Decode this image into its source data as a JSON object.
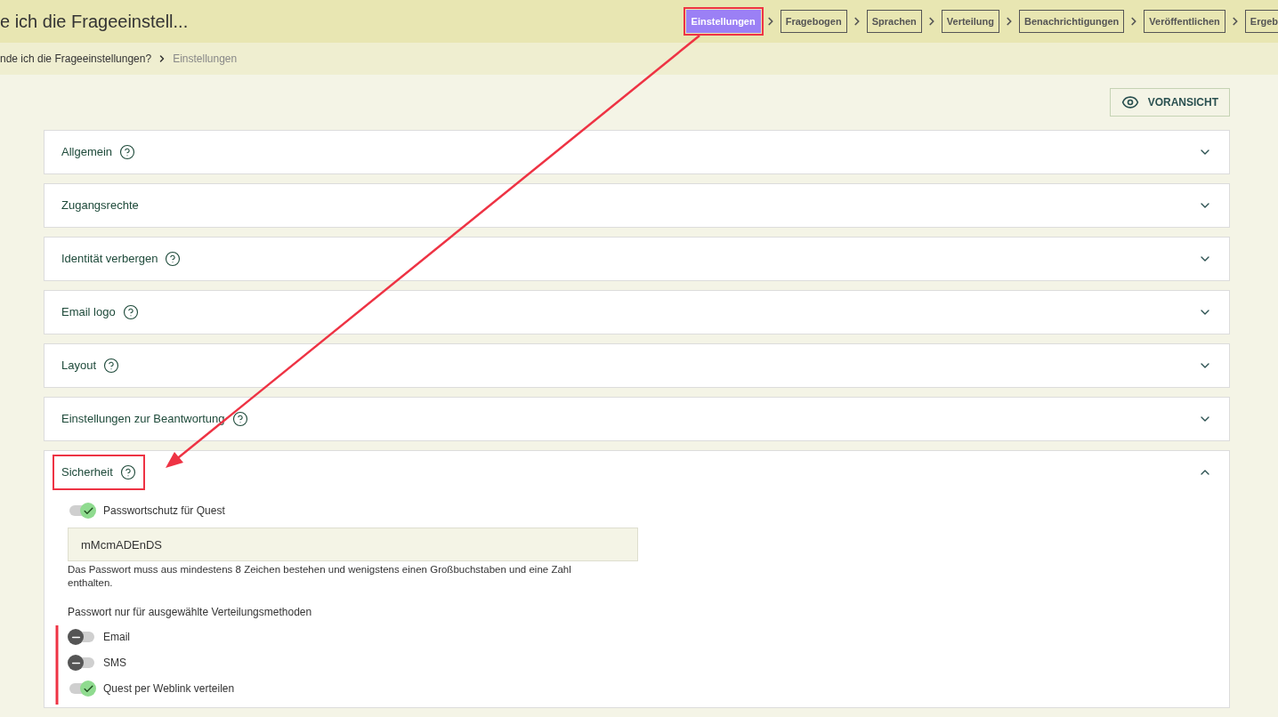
{
  "header": {
    "title": "e ich die Frageeinstell...",
    "steps": [
      {
        "label": "Einstellungen",
        "selected": true
      },
      {
        "label": "Fragebogen",
        "selected": false
      },
      {
        "label": "Sprachen",
        "selected": false
      },
      {
        "label": "Verteilung",
        "selected": false
      },
      {
        "label": "Benachrichtigungen",
        "selected": false
      },
      {
        "label": "Veröffentlichen",
        "selected": false
      },
      {
        "label": "Ergeb",
        "selected": false
      }
    ]
  },
  "breadcrumb": [
    "nde ich die Frageeinstellungen?",
    "Einstellungen"
  ],
  "preview_button": "VORANSICHT",
  "sections": [
    {
      "title": "Allgemein",
      "help": true,
      "expanded": false
    },
    {
      "title": "Zugangsrechte",
      "help": false,
      "expanded": false
    },
    {
      "title": "Identität verbergen",
      "help": true,
      "expanded": false
    },
    {
      "title": "Email logo",
      "help": true,
      "expanded": false
    },
    {
      "title": "Layout",
      "help": true,
      "expanded": false
    },
    {
      "title": "Einstellungen zur Beantwortung",
      "help": true,
      "expanded": false
    },
    {
      "title": "Sicherheit",
      "help": true,
      "expanded": true
    }
  ],
  "security": {
    "password_toggle": {
      "label": "Passwortschutz für Quest",
      "on": true
    },
    "password_value": "mMcmADEnDS",
    "hint": "Das Passwort muss aus mindestens 8 Zeichen bestehen und wenigstens einen Großbuchstaben und eine Zahl enthalten.",
    "methods_label": "Passwort nur für ausgewählte Verteilungsmethoden",
    "methods": [
      {
        "label": "Email",
        "on": false
      },
      {
        "label": "SMS",
        "on": false
      },
      {
        "label": "Quest per Weblink verteilen",
        "on": true
      }
    ]
  }
}
